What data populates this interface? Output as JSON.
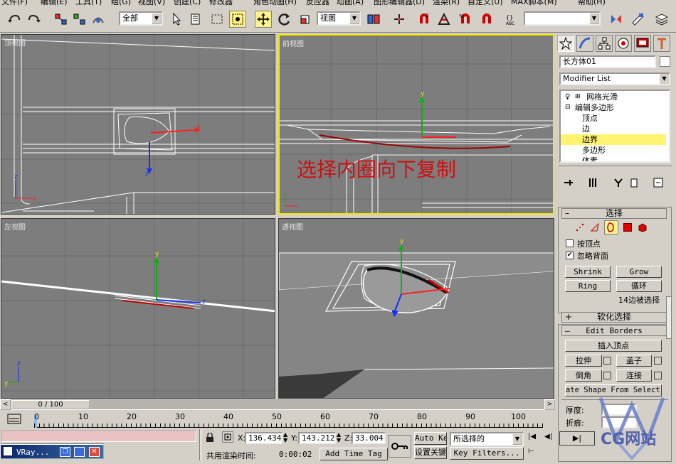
{
  "menu": [
    "文件(F)",
    "编辑(E)",
    "工具(T)",
    "组(G)",
    "视图(V)",
    "创建(C)",
    "修改器",
    "角色动画(H)",
    "反应器",
    "动画(A)",
    "图形编辑器(D)",
    "渲染(R)",
    "自定义(U)",
    "MAX脚本(M)",
    "帮助(H)"
  ],
  "toolbar": {
    "selection_filter": "全部",
    "ref_coord": "视图",
    "named_selection": ""
  },
  "viewports": {
    "top": {
      "label": "顶视图"
    },
    "front": {
      "label": "前视图",
      "annotation": "选择内圈向下复制"
    },
    "left": {
      "label": "左视图"
    },
    "perspective": {
      "label": "透视图"
    }
  },
  "axis_labels": {
    "x": "x",
    "y": "y",
    "z": "z"
  },
  "panel": {
    "object_name": "长方体01",
    "modifier_list": "Modifier List",
    "stack": {
      "item0": "网格光滑",
      "item1": "编辑多边形",
      "sub1": "顶点",
      "sub2": "边",
      "sub3": "边界",
      "sub4": "多边形",
      "sub5": "体素"
    },
    "select_roll": {
      "title": "选择",
      "by_vertex": "按顶点",
      "ignore_backface": "忽略背面",
      "shrink": "Shrink",
      "grow": "Grow",
      "ring": "Ring",
      "loop": "循环",
      "status": "14边被选择"
    },
    "soft_selection": "软化选择",
    "edit_borders": {
      "title": "Edit Borders",
      "insert_vertex": "插入顶点",
      "extrude": "拉伸",
      "cap": "盖子",
      "chamfer": "倒角",
      "connect": "连接",
      "create_shape": "ate Shape From Select",
      "thickness": "厚度:",
      "crease": "折痕:"
    }
  },
  "timeline": {
    "frame_counter": "0 / 100",
    "ticks": [
      "0",
      "10",
      "20",
      "30",
      "40",
      "50",
      "60",
      "70",
      "80",
      "90",
      "100"
    ]
  },
  "status": {
    "taskbar_item": "VRay...",
    "x_label": "X:",
    "x_value": "136.434",
    "y_label": "Y:",
    "y_value": "143.212",
    "z_label": "Z:",
    "z_value": "33.004",
    "render_time_label": "共用渲染时间:",
    "render_time": "0:00:02",
    "add_time_tag": "Add Time Tag",
    "auto_key": "Auto Key",
    "selected": "所选择的",
    "set_key": "设置关键点",
    "key_filters": "Key Filters...",
    "watermark": "CG网站"
  },
  "colors": {
    "active_border": "#f2e800",
    "selection_red": "#c00000",
    "viewport_bg": "#7d7d7d",
    "annotation": "#d01010"
  }
}
